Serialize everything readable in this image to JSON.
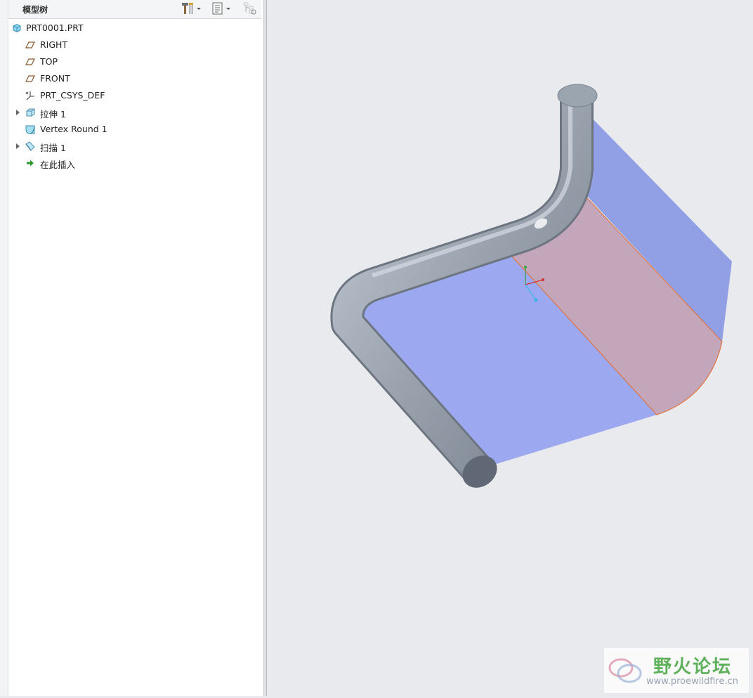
{
  "panel": {
    "title": "模型树",
    "toolbar": [
      {
        "icon": "hammer-tools-icon",
        "has_dropdown": true
      },
      {
        "icon": "tree-settings-icon",
        "has_dropdown": true
      },
      {
        "icon": "tree-filter-icon",
        "has_dropdown": false
      }
    ]
  },
  "tree": {
    "items": [
      {
        "label": "PRT0001.PRT",
        "icon": "part-icon",
        "expandable": false
      },
      {
        "label": "RIGHT",
        "icon": "datum-plane-icon",
        "expandable": false
      },
      {
        "label": "TOP",
        "icon": "datum-plane-icon",
        "expandable": false
      },
      {
        "label": "FRONT",
        "icon": "datum-plane-icon",
        "expandable": false
      },
      {
        "label": "PRT_CSYS_DEF",
        "icon": "csys-icon",
        "expandable": false
      },
      {
        "label": "拉伸 1",
        "icon": "extrude-icon",
        "expandable": true
      },
      {
        "label": "Vertex Round 1",
        "icon": "vertex-round-icon",
        "expandable": false
      },
      {
        "label": "扫描 1",
        "icon": "sweep-icon",
        "expandable": true
      },
      {
        "label": "在此插入",
        "icon": "insert-here-arrow-icon",
        "expandable": false
      }
    ]
  },
  "viewport": {
    "background": "#e9eaee",
    "colors": {
      "surface": "#98a4ee",
      "round_surface": "#c3a3b8",
      "round_edge": "#e0703a",
      "tube": "#9aa3ae"
    }
  },
  "watermark": {
    "title": "野火论坛",
    "url": "www.proewildfire.cn"
  }
}
